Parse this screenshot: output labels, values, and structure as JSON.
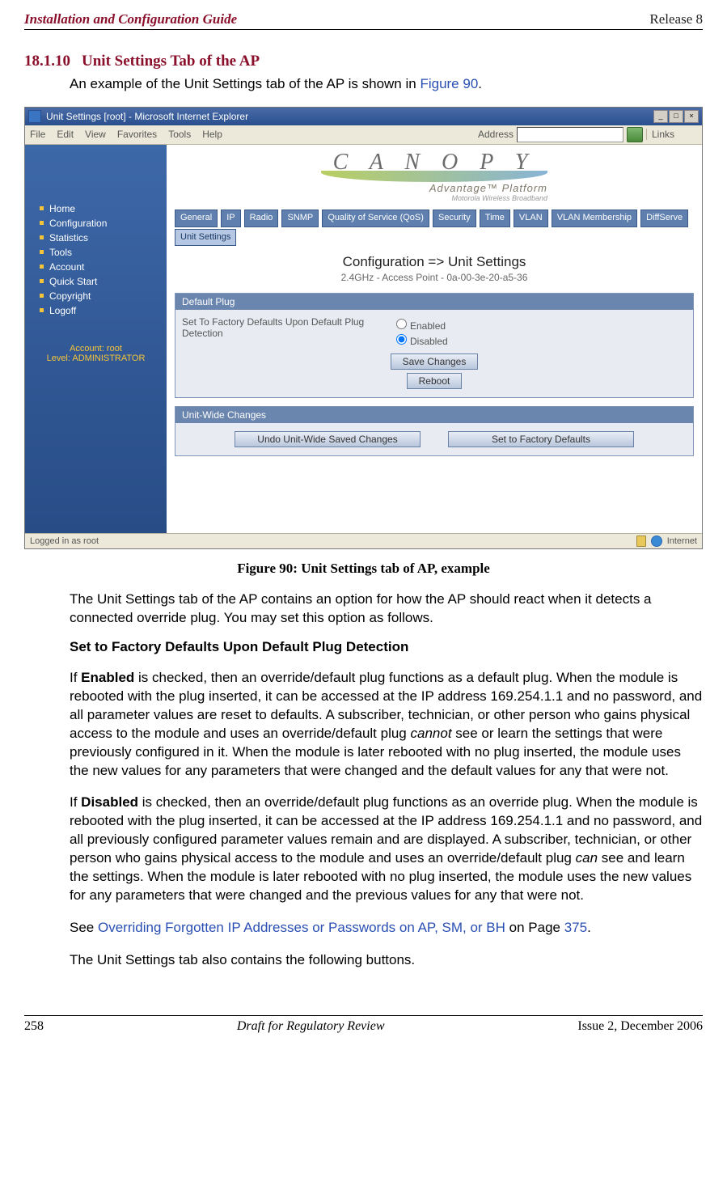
{
  "header": {
    "left": "Installation and Configuration Guide",
    "right": "Release 8"
  },
  "section": {
    "number": "18.1.10",
    "title": "Unit Settings Tab of the AP"
  },
  "intro": {
    "pre": "An example of the Unit Settings tab of the AP is shown in ",
    "figref": "Figure 90",
    "post": "."
  },
  "browser": {
    "title": "Unit Settings [root] - Microsoft Internet Explorer",
    "menus": [
      "File",
      "Edit",
      "View",
      "Favorites",
      "Tools",
      "Help"
    ],
    "address_label": "Address",
    "links_label": "Links",
    "status_left": "Logged in as root",
    "status_right": "Internet"
  },
  "app": {
    "logo": {
      "brand": "C A N O P Y",
      "sub": "Advantage™ Platform",
      "sub2": "Motorola Wireless Broadband"
    },
    "sidebar": {
      "items": [
        "Home",
        "Configuration",
        "Statistics",
        "Tools",
        "Account",
        "Quick Start",
        "Copyright",
        "Logoff"
      ],
      "acct1": "Account: root",
      "acct2": "Level: ADMINISTRATOR"
    },
    "tabs": [
      "General",
      "IP",
      "Radio",
      "SNMP",
      "Quality of Service (QoS)",
      "Security",
      "Time",
      "VLAN",
      "VLAN Membership",
      "DiffServe",
      "Unit Settings"
    ],
    "page_heading": "Configuration => Unit Settings",
    "page_sub": "2.4GHz - Access Point - 0a-00-3e-20-a5-36",
    "panel1": {
      "title": "Default Plug",
      "option_label": "Set To Factory Defaults Upon Default Plug Detection",
      "radio1": "Enabled",
      "radio2": "Disabled",
      "btn_save": "Save Changes",
      "btn_reboot": "Reboot"
    },
    "panel2": {
      "title": "Unit-Wide Changes",
      "btn_undo": "Undo Unit-Wide Saved Changes",
      "btn_factory": "Set to Factory Defaults"
    }
  },
  "caption": "Figure 90: Unit Settings tab of AP, example",
  "para_after_caption": "The Unit Settings tab of the AP contains an option for how the AP should react when it detects a connected override plug. You may set this option as follows.",
  "subheading": "Set to Factory Defaults Upon Default Plug Detection",
  "enabled_para": {
    "bold": "Enabled",
    "pre": "If ",
    "mid": " is checked, then an override/default plug functions as a default plug. When the module is rebooted with the plug inserted, it can be accessed at the IP address 169.254.1.1 and no password, and all parameter values are reset to defaults. A subscriber, technician, or other person who gains physical access to the module and uses an override/default plug ",
    "ital": "cannot",
    "post": " see or learn the settings that were previously configured in it. When the module is later rebooted with no plug inserted, the module uses the new values for any parameters that were changed and the default values for any that were not."
  },
  "disabled_para": {
    "bold": "Disabled",
    "pre": "If ",
    "mid": " is checked, then an override/default plug functions as an override plug. When the module is rebooted with the plug inserted, it can be accessed at the IP address 169.254.1.1 and no password, and all previously configured parameter values remain and are displayed. A subscriber, technician, or other person who gains physical access to the module and uses an override/default plug ",
    "ital": "can",
    "post": " see and learn the settings. When the module is later rebooted with no plug inserted, the module uses the new values for any parameters that were changed and the previous values for any that were not."
  },
  "see_line": {
    "pre": "See ",
    "link": "Overriding Forgotten IP Addresses or Passwords on AP, SM, or BH",
    "mid": " on Page ",
    "page": "375",
    "post": "."
  },
  "closing_para": "The Unit Settings tab also contains the following buttons.",
  "footer": {
    "left": "258",
    "mid": "Draft for Regulatory Review",
    "right": "Issue 2, December 2006"
  }
}
